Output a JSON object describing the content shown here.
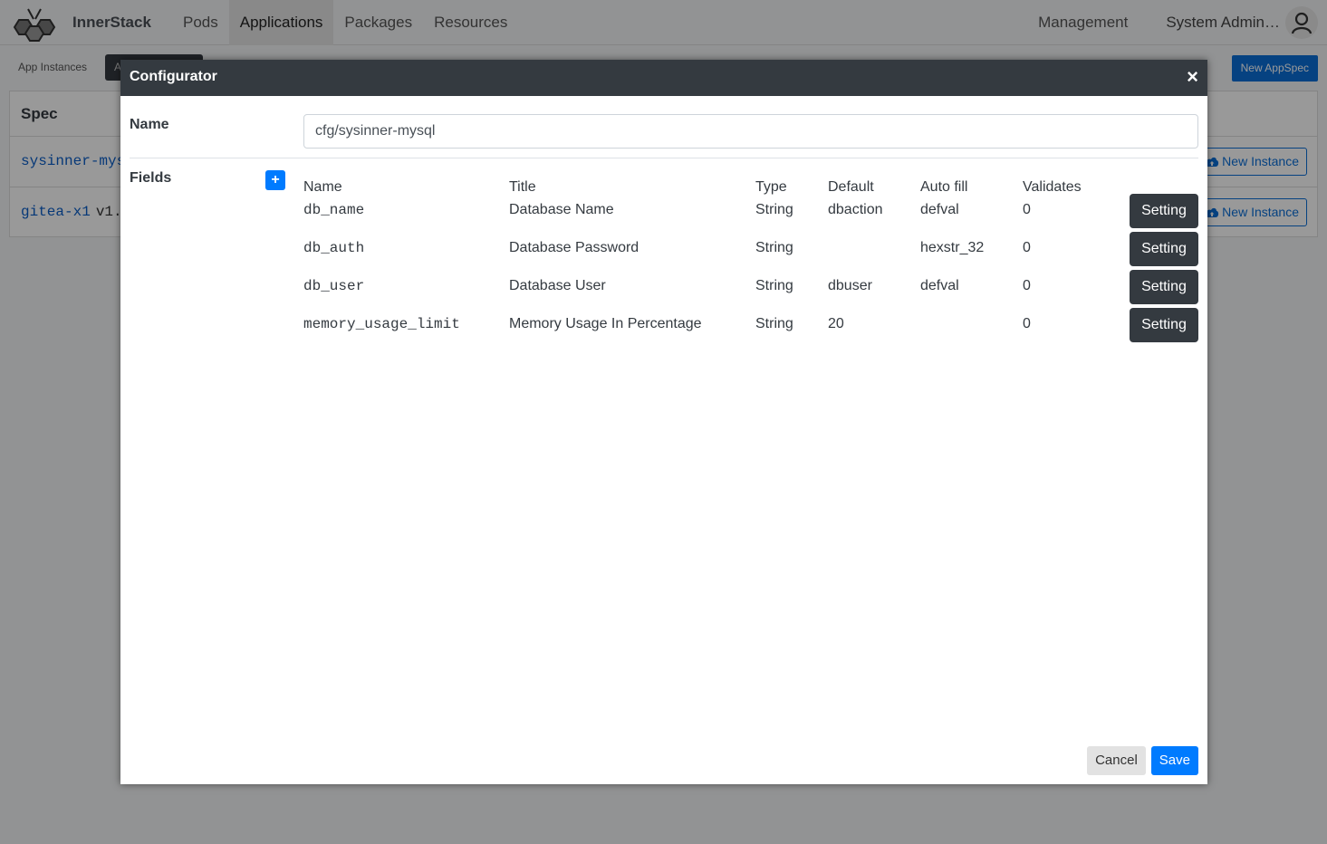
{
  "topbar": {
    "brand": "InnerStack",
    "nav": [
      {
        "label": "Pods",
        "active": false
      },
      {
        "label": "Applications",
        "active": true
      },
      {
        "label": "Packages",
        "active": false
      },
      {
        "label": "Resources",
        "active": false
      }
    ],
    "management": "Management",
    "user_name": "System Admin…",
    "logo_icon": "bee-hexagon-logo",
    "avatar_icon": "user-icon"
  },
  "subbar": {
    "tabs": [
      "App Instances",
      "A"
    ],
    "new_appspec": "New AppSpec"
  },
  "spec_table": {
    "header": "Spec",
    "rows": [
      {
        "name": "sysinner-mysql",
        "version": "",
        "action": "New Instance"
      },
      {
        "name": "gitea-x1",
        "version": "v1.",
        "action": "New Instance"
      }
    ],
    "action_icon": "cloud-upload-icon"
  },
  "modal": {
    "title": "Configurator",
    "close_icon": "×",
    "name_label": "Name",
    "name_value": "cfg/sysinner-mysql",
    "fields_label": "Fields",
    "add_icon": "+",
    "columns": [
      "Name",
      "Title",
      "Type",
      "Default",
      "Auto fill",
      "Validates"
    ],
    "rows": [
      {
        "name": "db_name",
        "title": "Database Name",
        "type": "String",
        "default": "dbaction",
        "auto_fill": "defval",
        "validates": "0",
        "action": "Setting"
      },
      {
        "name": "db_auth",
        "title": "Database Password",
        "type": "String",
        "default": "",
        "auto_fill": "hexstr_32",
        "validates": "0",
        "action": "Setting"
      },
      {
        "name": "db_user",
        "title": "Database User",
        "type": "String",
        "default": "dbuser",
        "auto_fill": "defval",
        "validates": "0",
        "action": "Setting"
      },
      {
        "name": "memory_usage_limit",
        "title": "Memory Usage In Percentage",
        "type": "String",
        "default": "20",
        "auto_fill": "",
        "validates": "0",
        "action": "Setting"
      }
    ],
    "cancel": "Cancel",
    "save": "Save"
  }
}
